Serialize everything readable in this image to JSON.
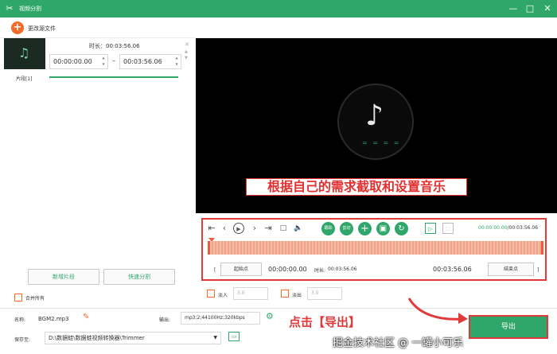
{
  "titlebar": {
    "title": "视频分割",
    "min": "—",
    "max": "□",
    "close": "✕"
  },
  "toolbar": {
    "add_label": "更改源文件"
  },
  "segment": {
    "label": "片段[1]",
    "duration_label": "时长：",
    "duration": "00:03:56.06",
    "start": "00:00:00.00",
    "end": "00:03:56.06",
    "separator": "–"
  },
  "left_buttons": {
    "add_segment": "新增片段",
    "fast_split": "快速分割",
    "merge_all": "合并所有"
  },
  "file": {
    "name_label": "名称:",
    "name": "BGM2.mp3",
    "output_label": "输出:",
    "output": "mp3;2;44100Hz;320kbps",
    "save_label": "保存至:",
    "save_path": "D:\\数据蛙\\数据蛙视频转换器\\Trimmer"
  },
  "player": {
    "caption": "根据自己的需求截取和设置音乐",
    "eq_bars": "= = = =",
    "time_current": "00:00:00.00",
    "time_total": "/00:03:56.06",
    "mute_label": "跟踪",
    "snap_label": "剪切"
  },
  "trim_row": {
    "start_btn": "起始点",
    "start_value": "00:00:00.00",
    "duration_label": "时长:",
    "duration": "00:03:56.06",
    "end_value": "00:03:56.06",
    "end_btn": "结束点"
  },
  "fade": {
    "fade_in_label": "淡入",
    "fade_in_value": "3.0",
    "fade_out_label": "淡出",
    "fade_out_value": "3.0"
  },
  "annotation": {
    "click_export": "点击【导出】",
    "watermark": "掘金技术社区 @ 一罐小可乐"
  },
  "export": {
    "label": "导出"
  },
  "colors": {
    "accent": "#2fa76a",
    "brand_orange": "#f26b2a",
    "highlight_red": "#e23a3a"
  }
}
